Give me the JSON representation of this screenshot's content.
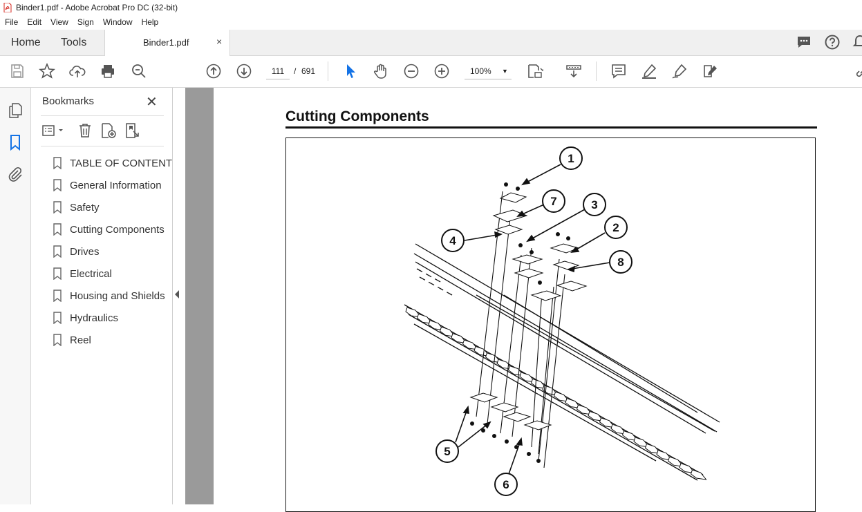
{
  "window": {
    "title": "Binder1.pdf - Adobe Acrobat Pro DC (32-bit)"
  },
  "menu": [
    "File",
    "Edit",
    "View",
    "Sign",
    "Window",
    "Help"
  ],
  "tabs": {
    "home": "Home",
    "tools": "Tools",
    "document": "Binder1.pdf",
    "close": "×"
  },
  "toolbar": {
    "page_current": "111",
    "page_separator": "/",
    "page_total": "691",
    "zoom": "100%",
    "icons": [
      "save-icon",
      "bookmark-star-icon",
      "upload-icon",
      "print-icon",
      "search-icon",
      "prev-page-icon",
      "next-page-icon",
      "select-icon",
      "hand-icon",
      "zoom-out-icon",
      "zoom-in-icon",
      "zoom-dropdown-icon",
      "fit-page-icon",
      "scroll-mode-icon",
      "comment-icon",
      "highlight-icon",
      "sign-icon",
      "fill-sign-icon"
    ]
  },
  "bookmarks": {
    "title": "Bookmarks",
    "items": [
      "TABLE OF CONTENT",
      "General Information",
      "Safety",
      "Cutting Components",
      "Drives",
      "Electrical",
      "Housing and Shields",
      "Hydraulics",
      "Reel"
    ]
  },
  "document": {
    "heading": "Cutting Components",
    "callouts": [
      "1",
      "2",
      "3",
      "4",
      "5",
      "6",
      "7",
      "8"
    ]
  },
  "colors": {
    "accent": "#1473e6",
    "doc_bg": "#9a9a9a",
    "tabbar_bg": "#f0f0f0"
  }
}
